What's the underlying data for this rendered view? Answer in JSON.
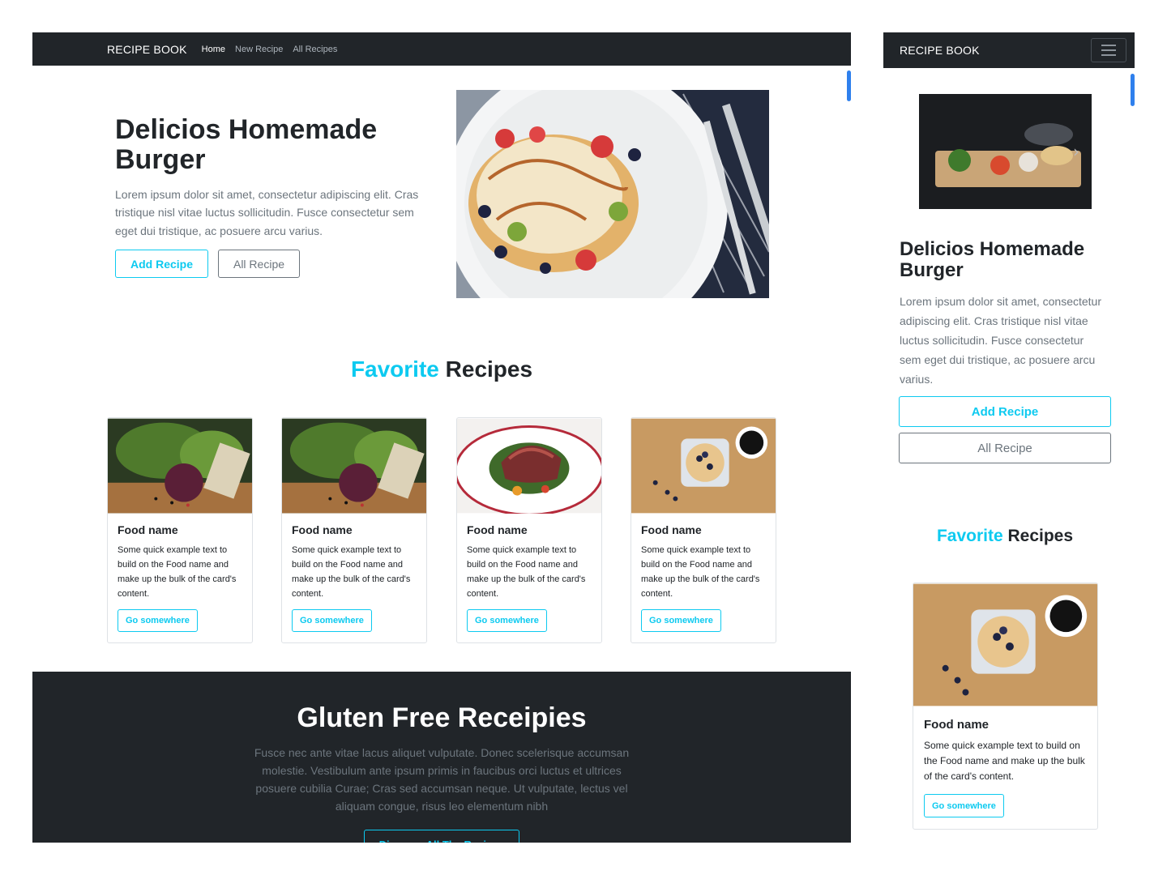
{
  "brand": "RECIPE BOOK",
  "nav": {
    "home": "Home",
    "new_recipe": "New Recipe",
    "all_recipes": "All Recipes"
  },
  "hero": {
    "title": "Delicios Homemade Burger",
    "text": "Lorem ipsum dolor sit amet, consectetur adipiscing elit. Cras tristique nisl vitae luctus sollicitudin. Fusce consectetur sem eget dui tristique, ac posuere arcu varius.",
    "add_btn": "Add Recipe",
    "all_btn": "All Recipe"
  },
  "favorites": {
    "accent": "Favorite",
    "rest": "Recipes"
  },
  "cards": [
    {
      "title": "Food name",
      "text": "Some quick example text to build on the Food name and make up the bulk of the card's content.",
      "button": "Go somewhere"
    },
    {
      "title": "Food name",
      "text": "Some quick example text to build on the Food name and make up the bulk of the card's content.",
      "button": "Go somewhere"
    },
    {
      "title": "Food name",
      "text": "Some quick example text to build on the Food name and make up the bulk of the card's content.",
      "button": "Go somewhere"
    },
    {
      "title": "Food name",
      "text": "Some quick example text to build on the Food name and make up the bulk of the card's content.",
      "button": "Go somewhere"
    }
  ],
  "mobile_card": {
    "title": "Food name",
    "text": "Some quick example text to build on the Food name and make up the bulk of the card's content.",
    "button": "Go somewhere"
  },
  "band": {
    "title": "Gluten Free Receipies",
    "text": "Fusce nec ante vitae lacus aliquet vulputate. Donec scelerisque accumsan molestie. Vestibulum ante ipsum primis in faucibus orci luctus et ultrices posuere cubilia Curae; Cras sed accumsan neque. Ut vulputate, lectus vel aliquam congue, risus leo elementum nibh",
    "button": "Discover All The Recipes"
  },
  "colors": {
    "dark": "#212529",
    "accent": "#0dcaf0",
    "muted": "#6c757d",
    "scroll": "#2f80ed"
  },
  "icons": {
    "menu": "hamburger-menu-icon"
  }
}
